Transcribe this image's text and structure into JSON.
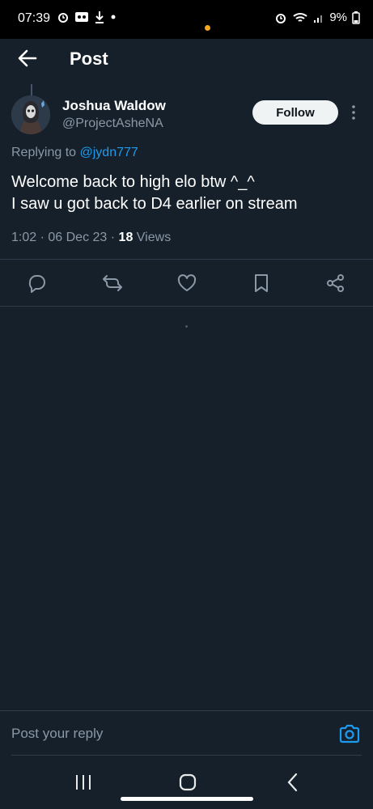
{
  "status_bar": {
    "time": "07:39",
    "battery": "9%",
    "left_icons": [
      "alarm-icon",
      "voicemail-icon",
      "download-icon",
      "dot-icon"
    ],
    "right_icons": [
      "alarm-icon",
      "wifi-icon",
      "signal-icon",
      "battery-icon"
    ]
  },
  "header": {
    "title": "Post"
  },
  "tweet": {
    "author_name": "Joshua Waldow",
    "author_handle": "@ProjectAsheNA",
    "follow_label": "Follow",
    "replying_prefix": "Replying to",
    "replying_mention": "@jydn777",
    "text_line1": "Welcome back to high elo btw ^_^",
    "text_line2": "I saw u got back to D4 earlier on stream",
    "time": "1:02",
    "date": "06 Dec 23",
    "views_count": "18",
    "views_label": "Views",
    "separator": "·"
  },
  "actions": [
    "reply-icon",
    "repost-icon",
    "like-icon",
    "bookmark-icon",
    "share-icon"
  ],
  "reply_bar": {
    "placeholder": "Post your reply"
  },
  "colors": {
    "background": "#15202b",
    "accent": "#1d9bf0",
    "secondary_text": "#8b98a5"
  }
}
